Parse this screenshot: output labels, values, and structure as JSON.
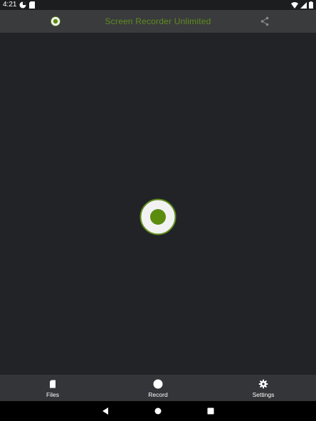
{
  "status_bar": {
    "time": "4:21",
    "left_icons": [
      "pie-status-icon",
      "sd-card-icon"
    ],
    "right_icons": [
      "wifi-icon",
      "signal-icon",
      "battery-icon"
    ]
  },
  "app_bar": {
    "title": "Screen Recorder Unlimited",
    "logo_icon": "record-logo-icon",
    "share_icon": "share-icon"
  },
  "main": {
    "record_button_icon": "record-icon"
  },
  "bottom_nav": {
    "items": [
      {
        "label": "Files",
        "icon": "sd-card-icon"
      },
      {
        "label": "Record",
        "icon": "circle-icon"
      },
      {
        "label": "Settings",
        "icon": "gear-icon"
      }
    ]
  },
  "system_nav": {
    "buttons": [
      "back-icon",
      "home-icon",
      "recents-icon"
    ]
  },
  "colors": {
    "accent": "#5f8c1e",
    "record_dot": "#5b8c0e",
    "record_ring_bg": "#f2f2f2",
    "app_bar_bg": "#3a3b3d",
    "main_bg": "#222326",
    "bottom_nav_bg": "#343538"
  }
}
